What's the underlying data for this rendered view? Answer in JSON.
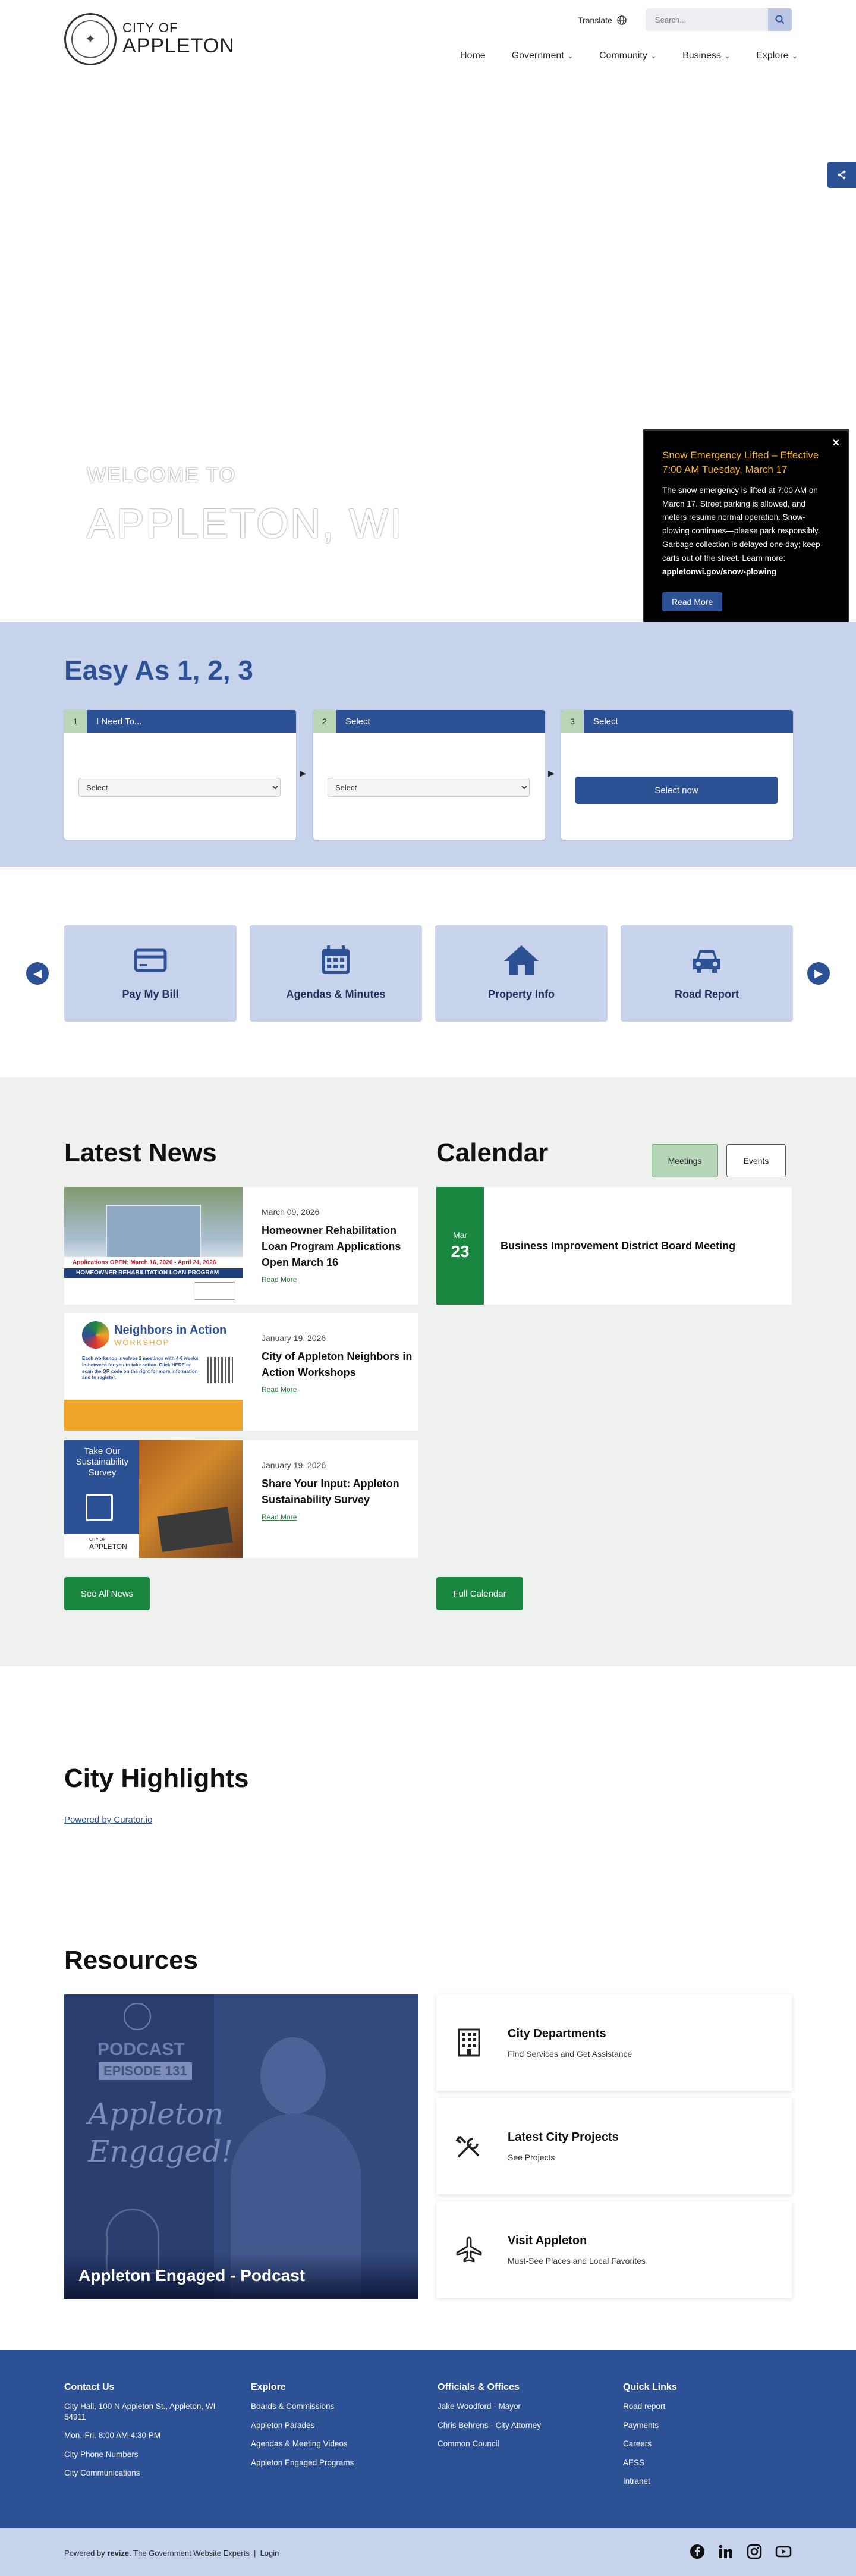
{
  "header": {
    "logo_line1": "CITY OF",
    "logo_line2": "APPLETON",
    "translate_label": "Translate",
    "search_placeholder": "Search...",
    "nav": [
      {
        "label": "Home",
        "has_menu": false
      },
      {
        "label": "Government",
        "has_menu": true
      },
      {
        "label": "Community",
        "has_menu": true
      },
      {
        "label": "Business",
        "has_menu": true
      },
      {
        "label": "Explore",
        "has_menu": true
      }
    ]
  },
  "hero": {
    "welcome": "WELCOME TO",
    "city": "APPLETON, WI"
  },
  "alert": {
    "title": "Snow Emergency Lifted – Effective 7:00 AM Tuesday, March 17",
    "body": "The snow emergency is lifted at 7:00 AM on March 17. Street parking is allowed, and meters resume normal operation. Snow-plowing continues—please park responsibly. Garbage collection is delayed one day; keep carts out of the street. Learn more:",
    "link": "appletonwi.gov/snow-plowing",
    "button": "Read More",
    "close": "×"
  },
  "easy": {
    "title": "Easy As 1, 2, 3",
    "steps": [
      {
        "num": "1",
        "label": "I Need To...",
        "select": "Select"
      },
      {
        "num": "2",
        "label": "Select",
        "select": "Select"
      },
      {
        "num": "3",
        "label": "Select",
        "button": "Select now"
      }
    ]
  },
  "quick_links": [
    {
      "label": "Pay My Bill",
      "icon": "credit-card-icon"
    },
    {
      "label": "Agendas & Minutes",
      "icon": "calendar-icon"
    },
    {
      "label": "Property Info",
      "icon": "house-icon"
    },
    {
      "label": "Road Report",
      "icon": "car-icon"
    }
  ],
  "news": {
    "title": "Latest News",
    "items": [
      {
        "date": "March 09, 2026",
        "headline": "Homeowner Rehabilitation Loan Program Applications Open March 16",
        "more": "Read More",
        "thumb_banner": "Applications OPEN: March 16, 2026 - April 24, 2026",
        "thumb_sub": "HOMEOWNER REHABILITATION LOAN PROGRAM"
      },
      {
        "date": "January 19, 2026",
        "headline": "City of Appleton Neighbors in Action Workshops",
        "more": "Read More",
        "thumb_title": "Neighbors in Action",
        "thumb_sub": "WORKSHOP",
        "thumb_text": "Each workshop involves 2 meetings with 4-6 weeks in-between for you to take action. Click HERE or scan the QR code on the right for more information and to register."
      },
      {
        "date": "January 19, 2026",
        "headline": "Share Your Input: Appleton Sustainability Survey",
        "more": "Read More",
        "thumb_title": "Take Our Sustainability Survey",
        "thumb_logo1": "CITY OF",
        "thumb_logo2": "APPLETON"
      }
    ],
    "see_all": "See All News"
  },
  "calendar": {
    "title": "Calendar",
    "tab_meetings": "Meetings",
    "tab_events": "Events",
    "event": {
      "month": "Mar",
      "day": "23",
      "title": "Business Improvement District Board Meeting"
    },
    "full": "Full Calendar"
  },
  "highlights": {
    "title": "City Highlights",
    "powered": "Powered by Curator.io"
  },
  "resources": {
    "title": "Resources",
    "podcast_caption": "Appleton Engaged - Podcast",
    "podcast_word": "PODCAST",
    "podcast_episode": "EPISODE 131",
    "podcast_script": "Appleton Engaged!",
    "cards": [
      {
        "title": "City Departments",
        "sub": "Find Services and Get Assistance",
        "icon": "building-icon"
      },
      {
        "title": "Latest City Projects",
        "sub": "See Projects",
        "icon": "tools-icon"
      },
      {
        "title": "Visit Appleton",
        "sub": "Must-See Places and Local Favorites",
        "icon": "airplane-icon"
      }
    ]
  },
  "footer": {
    "contact": {
      "title": "Contact Us",
      "items": [
        "City Hall, 100 N Appleton St., Appleton, WI 54911",
        "Mon.-Fri. 8:00 AM-4:30 PM",
        "City Phone Numbers",
        "City Communications"
      ]
    },
    "explore": {
      "title": "Explore",
      "items": [
        "Boards & Commissions",
        "Appleton Parades",
        "Agendas & Meeting Videos",
        "Appleton Engaged Programs"
      ]
    },
    "officials": {
      "title": "Officials & Offices",
      "items": [
        "Jake Woodford - Mayor",
        "Chris Behrens - City Attorney",
        "Common Council"
      ]
    },
    "quick": {
      "title": "Quick Links",
      "items": [
        "Road report",
        "Payments",
        "Careers",
        "AESS",
        "Intranet"
      ]
    }
  },
  "bottom": {
    "powered_prefix": "Powered by",
    "brand": "revize.",
    "powered_suffix": " The Government Website Experts",
    "sep": "|",
    "login": "Login"
  },
  "colors": {
    "primary": "#2d5195",
    "light": "#c7d3ea",
    "green": "#1a8740",
    "alert_title": "#f5b32c"
  }
}
